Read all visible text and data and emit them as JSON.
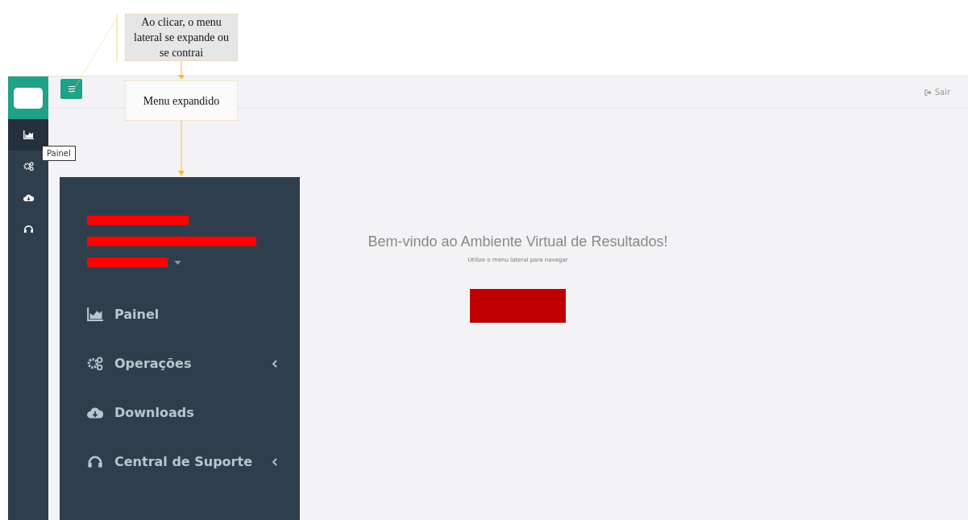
{
  "annotations": [
    {
      "text": "Ao clicar,  o menu lateral  se expande ou se contrai",
      "kind": "shaded"
    },
    {
      "text": "Menu expandido",
      "kind": "plain"
    }
  ],
  "mini_sidebar": {
    "items": [
      {
        "kind": "chart",
        "selected": true
      },
      {
        "kind": "gears",
        "selected": false
      },
      {
        "kind": "cloud",
        "selected": false
      },
      {
        "kind": "headset",
        "selected": false
      }
    ],
    "tooltip": "Painel"
  },
  "top_bar": {
    "logout": "Sair"
  },
  "expanded_menu": {
    "items": [
      {
        "label": "Painel",
        "kind": "chart",
        "has_submenu": false
      },
      {
        "label": "Operações",
        "kind": "gears",
        "has_submenu": true
      },
      {
        "label": "Downloads",
        "kind": "cloud",
        "has_submenu": false
      },
      {
        "label": "Central de Suporte",
        "kind": "headset",
        "has_submenu": true
      }
    ]
  },
  "welcome": {
    "title": "Bem-vindo ao Ambiente Virtual de Resultados!",
    "subtitle": "Utilize o menu lateral para navegar"
  }
}
